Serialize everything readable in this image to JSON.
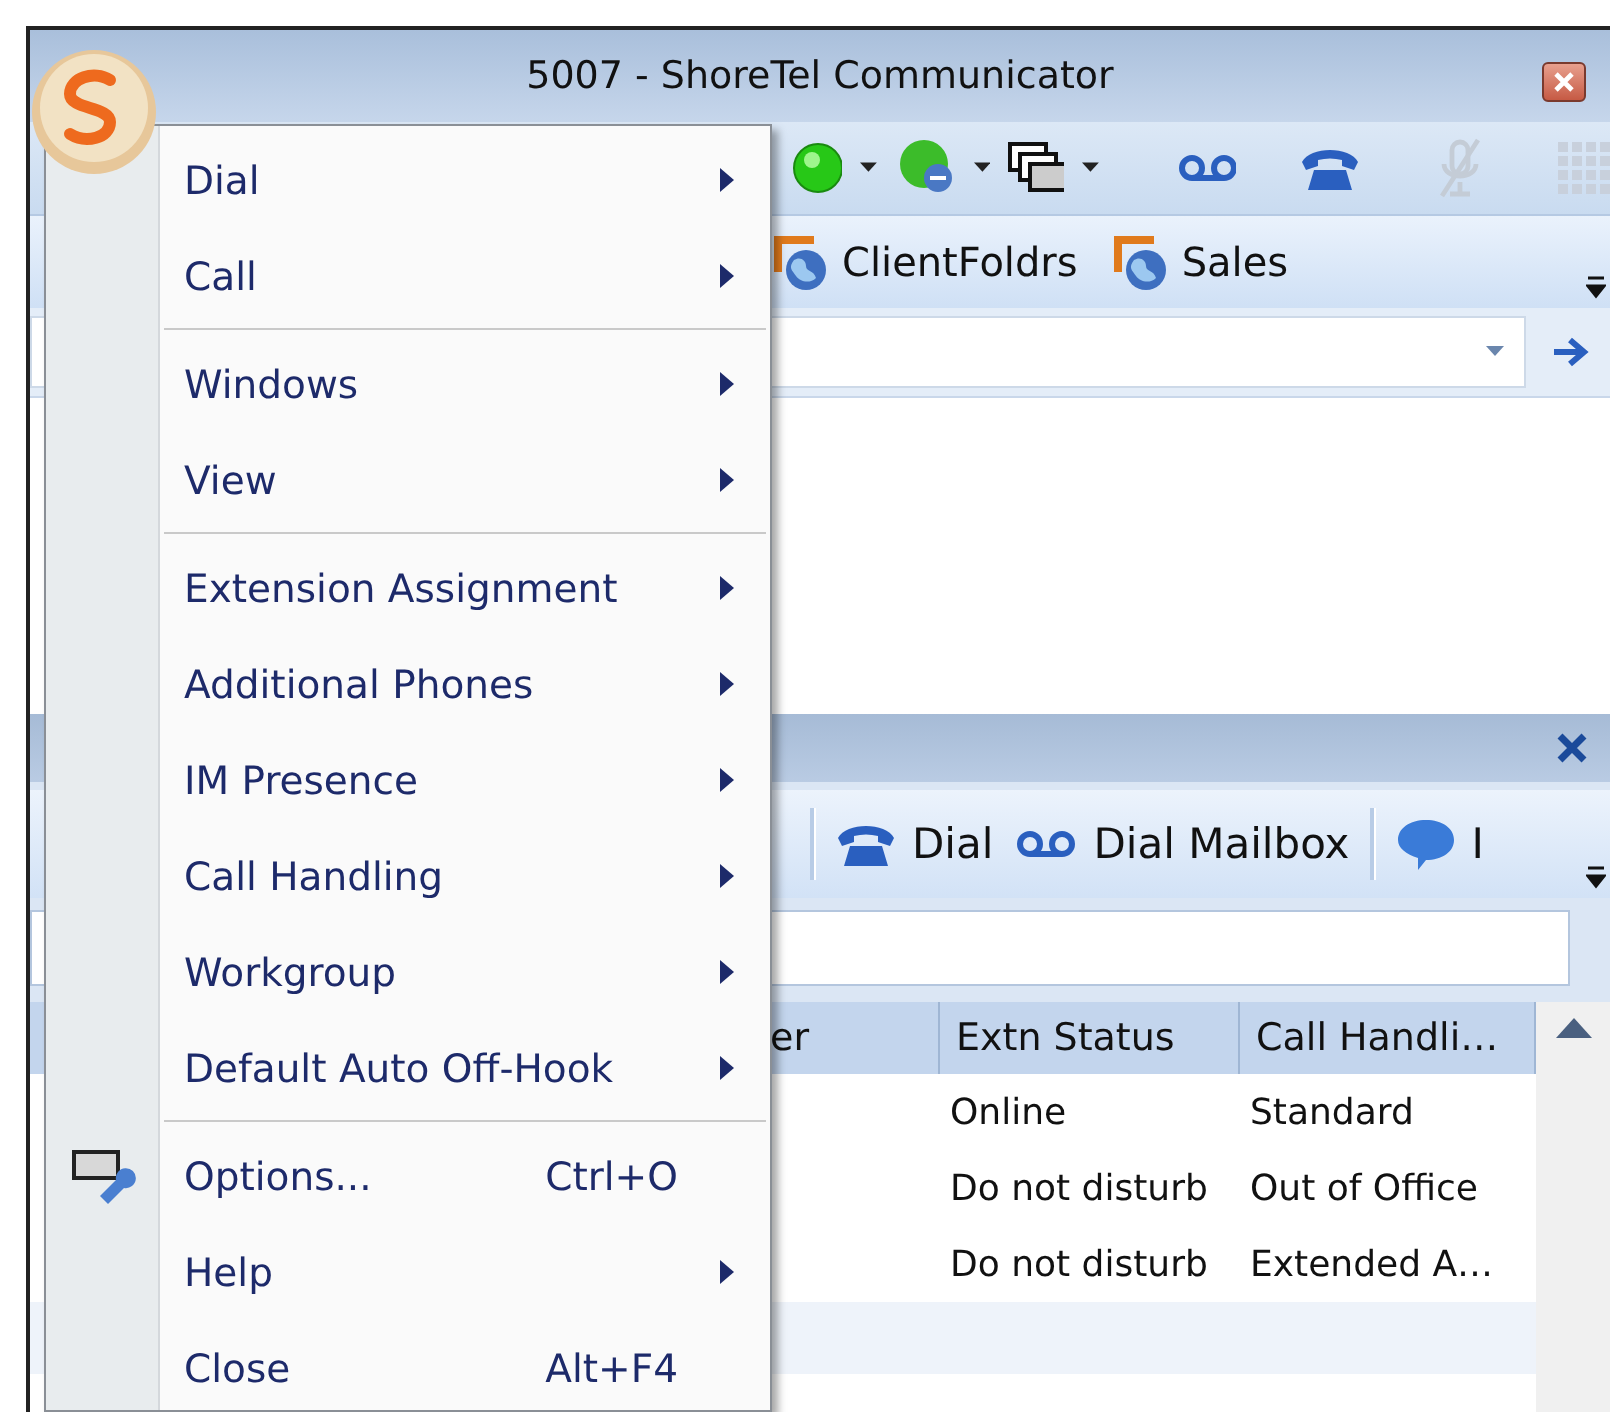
{
  "window": {
    "title": "5007 - ShoreTel Communicator"
  },
  "quick_dial_bar": {
    "items": [
      {
        "label": "ClientFoldrs"
      },
      {
        "label": "Sales"
      }
    ]
  },
  "panel": {
    "toolbar": [
      {
        "kind": "separator"
      },
      {
        "kind": "dial",
        "label": "Dial"
      },
      {
        "kind": "mailbox",
        "label": "Dial Mailbox"
      },
      {
        "kind": "separator"
      },
      {
        "kind": "im",
        "label": "I"
      }
    ],
    "columns": [
      "er",
      "Extn Status",
      "Call Handli…"
    ],
    "rows": [
      [
        "",
        "Online",
        "Standard"
      ],
      [
        "",
        "Do not disturb",
        "Out of Office"
      ],
      [
        "",
        "Do not disturb",
        "Extended A…"
      ]
    ]
  },
  "menu": {
    "items": [
      {
        "kind": "item",
        "label": "Dial",
        "submenu": true
      },
      {
        "kind": "item",
        "label": "Call",
        "submenu": true
      },
      {
        "kind": "separator"
      },
      {
        "kind": "item",
        "label": "Windows",
        "submenu": true
      },
      {
        "kind": "item",
        "label": "View",
        "submenu": true
      },
      {
        "kind": "separator"
      },
      {
        "kind": "item",
        "label": "Extension Assignment",
        "submenu": true
      },
      {
        "kind": "item",
        "label": "Additional Phones",
        "submenu": true
      },
      {
        "kind": "item",
        "label": "IM Presence",
        "submenu": true
      },
      {
        "kind": "item",
        "label": "Call Handling",
        "submenu": true
      },
      {
        "kind": "item",
        "label": "Workgroup",
        "submenu": true
      },
      {
        "kind": "item",
        "label": "Default Auto Off-Hook",
        "submenu": true
      },
      {
        "kind": "separator"
      },
      {
        "kind": "item",
        "label": "Options...",
        "shortcut": "Ctrl+O",
        "icon": true,
        "submenu": false
      },
      {
        "kind": "item",
        "label": "Help",
        "submenu": true
      },
      {
        "kind": "item",
        "label": "Close",
        "shortcut": "Alt+F4",
        "submenu": false
      }
    ]
  }
}
